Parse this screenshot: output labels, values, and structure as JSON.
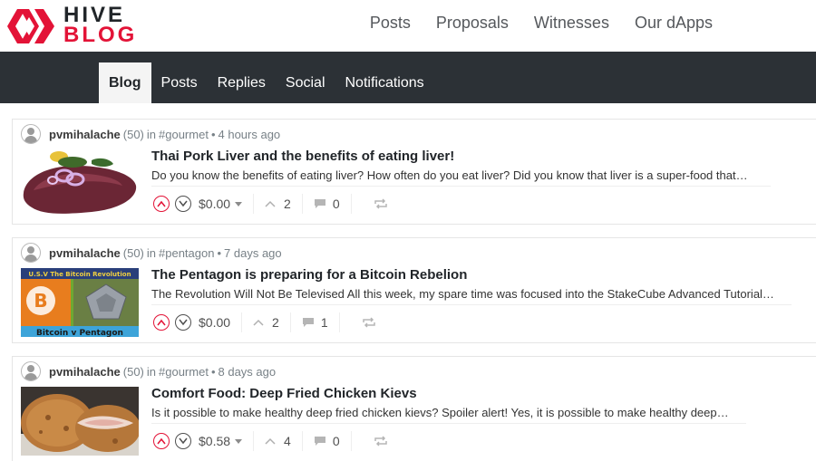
{
  "header": {
    "logo": {
      "line1": "HIVE",
      "line2": "BLOG"
    },
    "nav": [
      {
        "label": "Posts"
      },
      {
        "label": "Proposals"
      },
      {
        "label": "Witnesses"
      },
      {
        "label": "Our dApps"
      }
    ]
  },
  "subnav": {
    "tabs": [
      {
        "label": "Blog",
        "active": true
      },
      {
        "label": "Posts"
      },
      {
        "label": "Replies"
      },
      {
        "label": "Social"
      },
      {
        "label": "Notifications"
      }
    ]
  },
  "posts": [
    {
      "author": "pvmihalache",
      "reputation": "(50)",
      "in": "in",
      "category": "#gourmet",
      "dot": "•",
      "time": "4 hours ago",
      "title": "Thai Pork Liver and the benefits of eating liver!",
      "excerpt": "Do you know the benefits of eating liver? How often do you eat liver? Did you know that liver is a super-food that…",
      "payout": "$0.00",
      "votes": "2",
      "comments": "0",
      "thumbnail": "liver-dish"
    },
    {
      "author": "pvmihalache",
      "reputation": "(50)",
      "in": "in",
      "category": "#pentagon",
      "dot": "•",
      "time": "7 days ago",
      "title": "The Pentagon is preparing for a Bitcoin Rebelion",
      "excerpt": "The Revolution Will Not Be Televised All this week, my spare time was focused into the StakeCube Advanced Tutorial…",
      "payout": "$0.00",
      "votes": "2",
      "comments": "1",
      "thumbnail": "bitcoin-vs-pentagon",
      "thumb_text_top": "U.S.V The Bitcoin Revolution",
      "thumb_text_bottom": "Bitcoin v Pentagon"
    },
    {
      "author": "pvmihalache",
      "reputation": "(50)",
      "in": "in",
      "category": "#gourmet",
      "dot": "•",
      "time": "8 days ago",
      "title": "Comfort Food: Deep Fried Chicken Kievs",
      "excerpt": "Is it possible to make healthy deep fried chicken kievs? Spoiler alert! Yes, it is possible to make healthy deep…",
      "payout": "$0.58",
      "votes": "4",
      "comments": "0",
      "thumbnail": "chicken-kievs"
    }
  ],
  "colors": {
    "accent": "#e31337",
    "subnav_bg": "#2c3136"
  }
}
